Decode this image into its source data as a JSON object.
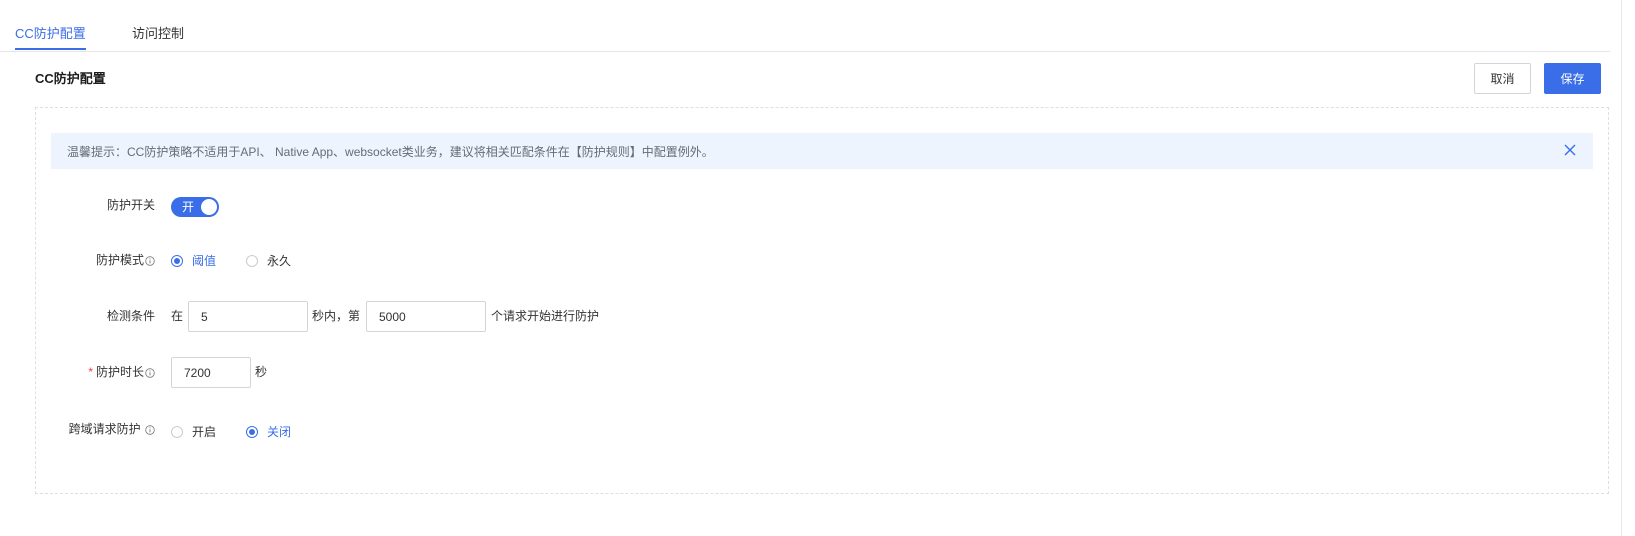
{
  "tabs": [
    {
      "label": "CC防护配置",
      "active": true
    },
    {
      "label": "访问控制",
      "active": false
    }
  ],
  "header": {
    "title": "CC防护配置",
    "cancel_label": "取消",
    "save_label": "保存"
  },
  "notice": {
    "text": "温馨提示：CC防护策略不适用于API、 Native App、websocket类业务，建议将相关匹配条件在【防护规则】中配置例外。"
  },
  "form": {
    "switch": {
      "label": "防护开关",
      "state_text": "开",
      "on": true
    },
    "mode": {
      "label": "防护模式",
      "options": [
        "阈值",
        "永久"
      ],
      "selected": "阈值"
    },
    "detect": {
      "label": "检测条件",
      "prefix": "在",
      "seconds": "5",
      "middle": "秒内，第",
      "count": "5000",
      "suffix": "个请求开始进行防护"
    },
    "duration": {
      "label": "防护时长",
      "required_mark": "*",
      "value": "7200",
      "unit": "秒"
    },
    "cross": {
      "label": "跨域请求防护",
      "options": [
        "开启",
        "关闭"
      ],
      "selected": "关闭"
    }
  },
  "colors": {
    "accent": "#3a6ee8",
    "notice_bg": "#eef4fd",
    "required": "#e54545"
  }
}
